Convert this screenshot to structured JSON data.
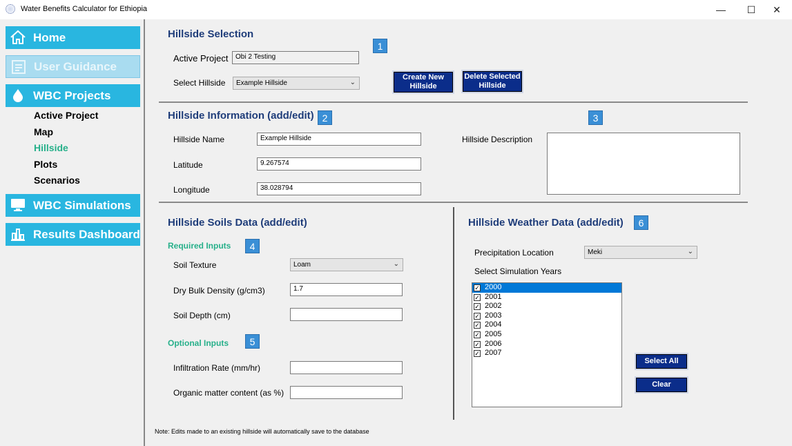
{
  "window": {
    "title": "Water Benefits Calculator for Ethiopia",
    "minimize": "—",
    "maximize": "☐",
    "close": "✕"
  },
  "sidebar": {
    "home": "Home",
    "user_guidance": "User Guidance",
    "wbc_projects": "WBC Projects",
    "subitems": [
      "Active Project",
      "Map",
      "Hillside",
      "Plots",
      "Scenarios"
    ],
    "wbc_simulations": "WBC Simulations",
    "results_dashboard": "Results Dashboard"
  },
  "selection": {
    "heading": "Hillside Selection",
    "badge": "1",
    "active_project_label": "Active Project",
    "active_project_value": "Obi 2 Testing",
    "select_hillside_label": "Select Hillside",
    "select_hillside_value": "Example Hillside",
    "create_btn": "Create New Hillside",
    "delete_btn": "Delete Selected Hillside"
  },
  "info": {
    "heading": "Hillside Information (add/edit)",
    "badge": "2",
    "badge_desc": "3",
    "name_label": "Hillside Name",
    "name_value": "Example Hillside",
    "lat_label": "Latitude",
    "lat_value": "9.267574",
    "lon_label": "Longitude",
    "lon_value": "38.028794",
    "desc_label": "Hillside Description",
    "desc_value": ""
  },
  "soils": {
    "heading": "Hillside Soils Data (add/edit)",
    "required_label": "Required Inputs",
    "badge_req": "4",
    "texture_label": "Soil Texture",
    "texture_value": "Loam",
    "density_label": "Dry Bulk Density (g/cm3)",
    "density_value": "1.7",
    "depth_label": "Soil Depth (cm)",
    "depth_value": "",
    "optional_label": "Optional Inputs",
    "badge_opt": "5",
    "infiltration_label": "Infiltration Rate (mm/hr)",
    "infiltration_value": "",
    "organic_label": "Organic matter content (as %)",
    "organic_value": ""
  },
  "weather": {
    "heading": "Hillside Weather Data (add/edit)",
    "badge": "6",
    "precip_label": "Precipitation Location",
    "precip_value": "Meki",
    "years_label": "Select Simulation Years",
    "years": [
      "2000",
      "2001",
      "2002",
      "2003",
      "2004",
      "2005",
      "2006",
      "2007"
    ],
    "selected_year": "2000",
    "select_all_btn": "Select All",
    "clear_btn": "Clear"
  },
  "note": "Note: Edits made to an existing hillside will automatically save to the database",
  "colors": {
    "nav": "#29b6e0",
    "heading": "#1f3d7a",
    "green": "#27b08a",
    "button": "#0b2d8a",
    "badge": "#3a8fd6"
  }
}
